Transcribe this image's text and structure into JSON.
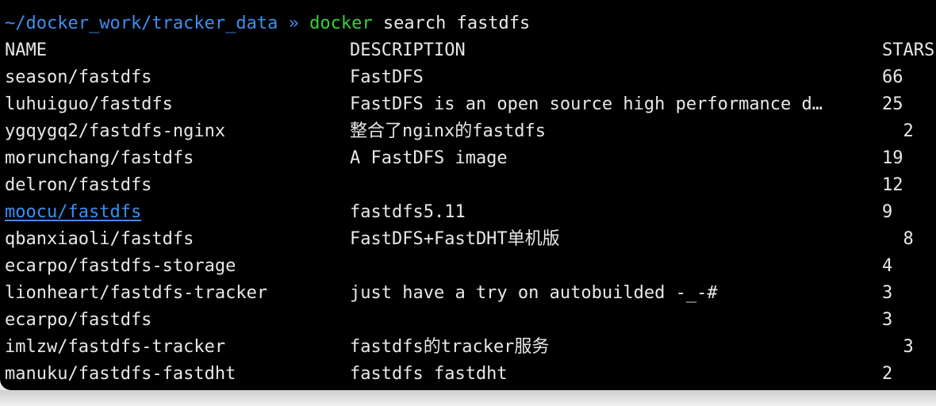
{
  "prompt": {
    "path": "~/docker_work/tracker_data",
    "separator": "»",
    "command": "docker",
    "args": "search fastdfs"
  },
  "table": {
    "headers": {
      "name": "NAME",
      "description": "DESCRIPTION",
      "stars": "STARS"
    },
    "rows": [
      {
        "name": "season/fastdfs",
        "description": "FastDFS",
        "stars": "66",
        "stars_offset": 0
      },
      {
        "name": "luhuiguo/fastdfs",
        "description": "FastDFS is an open source high performance d…",
        "stars": "25",
        "stars_offset": 0
      },
      {
        "name": "ygqygq2/fastdfs-nginx",
        "description": "整合了nginx的fastdfs",
        "stars": "2",
        "stars_offset": 1
      },
      {
        "name": "morunchang/fastdfs",
        "description": "A FastDFS image",
        "stars": "19",
        "stars_offset": 0
      },
      {
        "name": "delron/fastdfs",
        "description": "",
        "stars": "12",
        "stars_offset": 0
      },
      {
        "name": "moocu/fastdfs",
        "description": "fastdfs5.11",
        "stars": "9",
        "stars_offset": 0,
        "link": true
      },
      {
        "name": "qbanxiaoli/fastdfs",
        "description": "FastDFS+FastDHT单机版",
        "stars": "8",
        "stars_offset": 1
      },
      {
        "name": "ecarpo/fastdfs-storage",
        "description": "",
        "stars": "4",
        "stars_offset": 0
      },
      {
        "name": "lionheart/fastdfs-tracker",
        "description": "just have a try on autobuilded -_-#",
        "stars": "3",
        "stars_offset": 0
      },
      {
        "name": "ecarpo/fastdfs",
        "description": "",
        "stars": "3",
        "stars_offset": 0
      },
      {
        "name": "imlzw/fastdfs-tracker",
        "description": "fastdfs的tracker服务",
        "stars": "3",
        "stars_offset": 1
      },
      {
        "name": "manuku/fastdfs-fastdht",
        "description": "fastdfs fastdht",
        "stars": "2",
        "stars_offset": 0
      }
    ]
  },
  "colors": {
    "background": "#000000",
    "text": "#e8e8e8",
    "path": "#3d8ff0",
    "command": "#37d23c",
    "link": "#3d8ff0"
  }
}
